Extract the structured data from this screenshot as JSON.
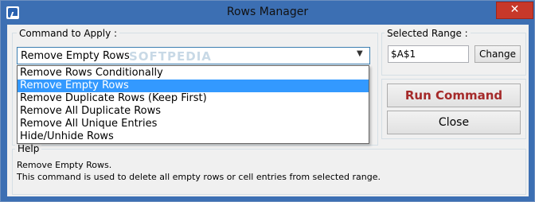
{
  "window": {
    "title": "Rows Manager"
  },
  "command_group": {
    "label": "Command to Apply :",
    "selected_value": "Remove Empty Rows",
    "watermark": "SOFTPEDIA",
    "options": [
      "Remove Rows Conditionally",
      "Remove Empty Rows",
      "Remove Duplicate Rows (Keep First)",
      "Remove All Duplicate Rows",
      "Remove All Unique Entries",
      "Hide/Unhide Rows"
    ],
    "selected_index": 1
  },
  "range_group": {
    "label": "Selected Range :",
    "value": "$A$1",
    "change_label": "Change"
  },
  "actions": {
    "run_label": "Run Command",
    "close_label": "Close",
    "run_color": "#a52a2a"
  },
  "help": {
    "label": "Help",
    "line1": "Remove Empty Rows.",
    "line2": "This command is used to delete all empty rows or cell entries from selected range."
  },
  "icons": {
    "app": "app-icon",
    "close": "close-icon",
    "dropdown": "chevron-down-icon"
  },
  "colors": {
    "titlebar": "#3c6fb3",
    "close_button": "#c7382a",
    "selection": "#3399ff"
  }
}
